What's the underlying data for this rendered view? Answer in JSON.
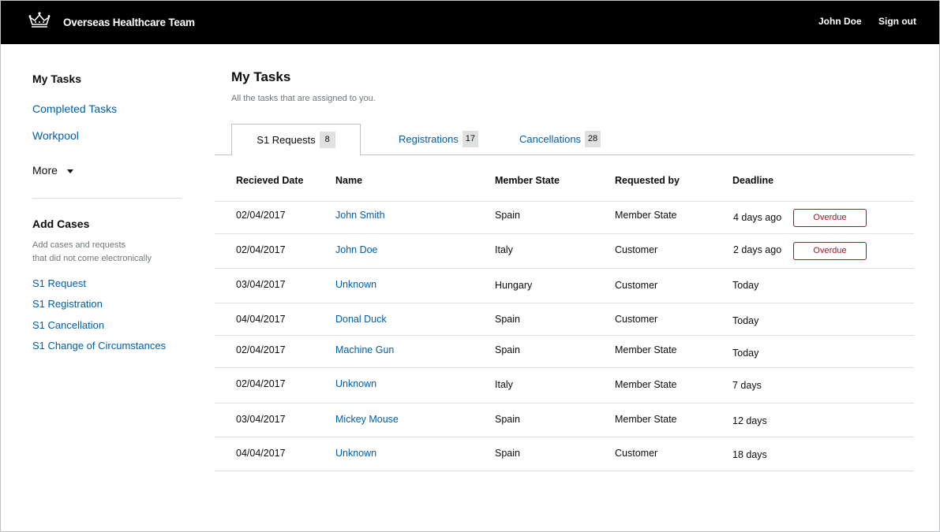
{
  "header": {
    "title": "Overseas Healthcare Team",
    "user_name": "John Doe",
    "sign_out": "Sign out",
    "logo_icon": "crown-icon"
  },
  "sidebar": {
    "heading": "My Tasks",
    "links": [
      "Completed Tasks",
      "Workpool"
    ],
    "more": "More",
    "add_cases": {
      "heading": "Add Cases",
      "description_line1": "Add cases and requests",
      "description_line2": "that did not come electronically",
      "links": [
        "S1 Request",
        "S1 Registration",
        "S1 Cancellation",
        "S1 Change of Circumstances"
      ]
    }
  },
  "main": {
    "title": "My Tasks",
    "subtitle": "All the tasks that are assigned to you.",
    "tabs": [
      {
        "label": "S1 Requests",
        "count": "8",
        "active": true
      },
      {
        "label": "Registrations",
        "count": "17",
        "active": false
      },
      {
        "label": "Cancellations",
        "count": "28",
        "active": false
      }
    ],
    "table": {
      "headers": [
        "Recieved Date",
        "Name",
        "Member State",
        "Requested by",
        "Deadline"
      ],
      "rows": [
        {
          "date": "02/04/2017",
          "name": "John Smith",
          "state": "Spain",
          "requested_by": "Member State",
          "deadline": "4 days ago",
          "status": "Overdue"
        },
        {
          "date": "02/04/2017",
          "name": "John Doe",
          "state": "Italy",
          "requested_by": "Customer",
          "deadline": "2 days ago",
          "status": "Overdue"
        },
        {
          "date": "03/04/2017",
          "name": "Unknown",
          "state": "Hungary",
          "requested_by": "Customer",
          "deadline": "Today",
          "status": ""
        },
        {
          "date": "04/04/2017",
          "name": "Donal Duck",
          "state": "Spain",
          "requested_by": "Customer",
          "deadline": "Today",
          "status": ""
        },
        {
          "date": "02/04/2017",
          "name": "Machine Gun",
          "state": "Spain",
          "requested_by": "Member State",
          "deadline": "Today",
          "status": ""
        },
        {
          "date": "02/04/2017",
          "name": "Unknown",
          "state": "Italy",
          "requested_by": "Member State",
          "deadline": "7 days",
          "status": ""
        },
        {
          "date": "03/04/2017",
          "name": "Mickey Mouse",
          "state": "Spain",
          "requested_by": "Member State",
          "deadline": "12 days",
          "status": ""
        },
        {
          "date": "04/04/2017",
          "name": "Unknown",
          "state": "Spain",
          "requested_by": "Customer",
          "deadline": "18 days",
          "status": ""
        }
      ]
    }
  },
  "colors": {
    "link": "#005ea5",
    "header_bg": "#000000",
    "overdue": "#b10e1e",
    "muted_text": "#6f777b"
  }
}
